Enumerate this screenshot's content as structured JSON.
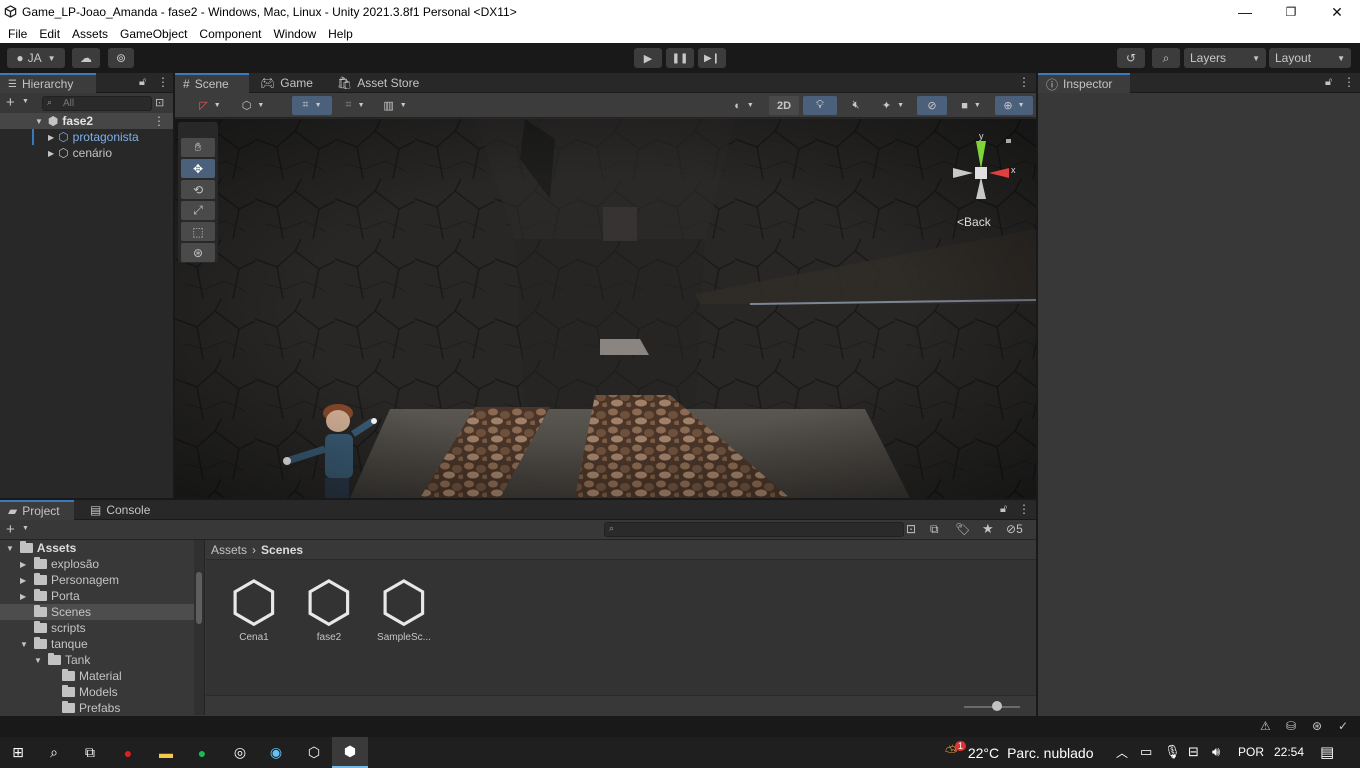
{
  "window": {
    "title": "Game_LP-Joao_Amanda - fase2 - Windows, Mac, Linux - Unity 2021.3.8f1 Personal <DX11>"
  },
  "menu": [
    "File",
    "Edit",
    "Assets",
    "GameObject",
    "Component",
    "Window",
    "Help"
  ],
  "toolbar": {
    "account": "JA",
    "layers": "Layers",
    "layout": "Layout"
  },
  "hierarchy": {
    "tab": "Hierarchy",
    "search_placeholder": "All",
    "scene": "fase2",
    "items": [
      "protagonista",
      "cenário"
    ]
  },
  "scene_panel": {
    "tabs": [
      "Scene",
      "Game",
      "Asset Store"
    ],
    "toggle_2d": "2D",
    "gizmo": {
      "y": "y",
      "x": "x",
      "back": "Back"
    }
  },
  "inspector": {
    "tab": "Inspector"
  },
  "project": {
    "tabs": [
      "Project",
      "Console"
    ],
    "hidden_count": "5",
    "tree": {
      "root": "Assets",
      "items": [
        {
          "label": "explosão",
          "level": 1,
          "expanded": false,
          "has_children": true
        },
        {
          "label": "Personagem",
          "level": 1,
          "expanded": false,
          "has_children": true
        },
        {
          "label": "Porta",
          "level": 1,
          "expanded": false,
          "has_children": true
        },
        {
          "label": "Scenes",
          "level": 1,
          "expanded": false,
          "has_children": false,
          "selected": true
        },
        {
          "label": "scripts",
          "level": 1,
          "expanded": false,
          "has_children": false
        },
        {
          "label": "tanque",
          "level": 1,
          "expanded": true,
          "has_children": true
        },
        {
          "label": "Tank",
          "level": 2,
          "expanded": true,
          "has_children": true
        },
        {
          "label": "Material",
          "level": 3,
          "expanded": false,
          "has_children": false
        },
        {
          "label": "Models",
          "level": 3,
          "expanded": false,
          "has_children": false
        },
        {
          "label": "Prefabs",
          "level": 3,
          "expanded": false,
          "has_children": false
        }
      ]
    },
    "breadcrumb": [
      "Assets",
      "Scenes"
    ],
    "assets": [
      "Cena1",
      "fase2",
      "SampleSc..."
    ]
  },
  "taskbar": {
    "temperature": "22°C",
    "weather": "Parc. nublado",
    "weather_badge": "1",
    "language": "POR",
    "time": "22:54"
  },
  "colors": {
    "accent": "#3a79bb",
    "selected_row": "#2c5d87",
    "hierarchy_child_text": "#7cb1ea"
  }
}
